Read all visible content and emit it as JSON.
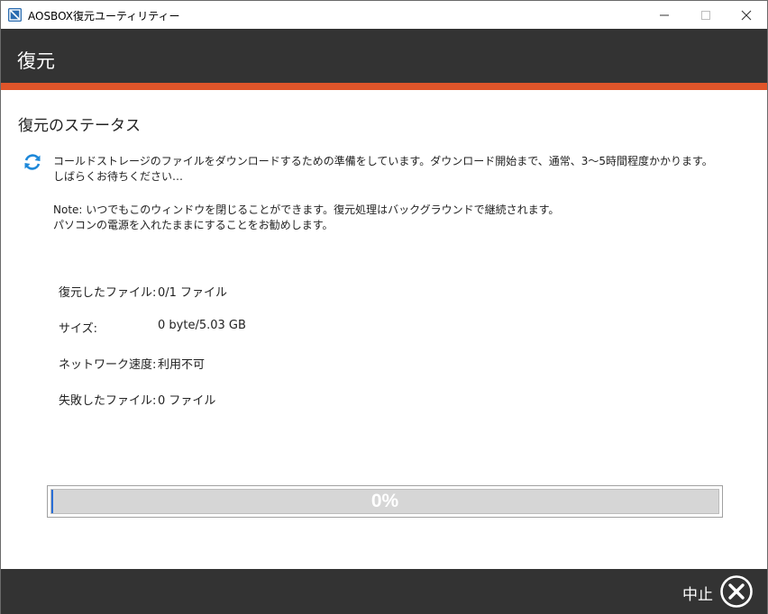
{
  "window": {
    "title": "AOSBOX復元ユーティリティー"
  },
  "header": {
    "title": "復元"
  },
  "status": {
    "section_title": "復元のステータス",
    "message_line1": "コールドストレージのファイルをダウンロードするための準備をしています。ダウンロード開始まで、通常、3～5時間程度かかります。",
    "message_line2": "しばらくお待ちください…",
    "note_line1": "Note: いつでもこのウィンドウを閉じることができます。復元処理はバックグラウンドで継続されます。",
    "note_line2": "パソコンの電源を入れたままにすることをお勧めします。"
  },
  "info": [
    {
      "label": "復元したファイル:",
      "value": "0/1 ファイル"
    },
    {
      "label": "サイズ:",
      "value": "0 byte/5.03 GB"
    },
    {
      "label": "ネットワーク速度:",
      "value": "利用不可"
    },
    {
      "label": "失敗したファイル:",
      "value": "0 ファイル"
    }
  ],
  "progress": {
    "percent": 0,
    "label": "0%"
  },
  "footer": {
    "stop_label": "中止"
  },
  "icons": {
    "app": "app-logo-icon",
    "refresh": "refresh-icon",
    "stop": "close-circle-icon",
    "minimize": "minimize-icon",
    "maximize": "maximize-icon",
    "close": "close-icon"
  },
  "colors": {
    "header_bg": "#333333",
    "accent": "#e0552a",
    "refresh_icon": "#1e88d9",
    "progress_fill": "#2a6fd6",
    "progress_track": "#d6d6d6"
  }
}
